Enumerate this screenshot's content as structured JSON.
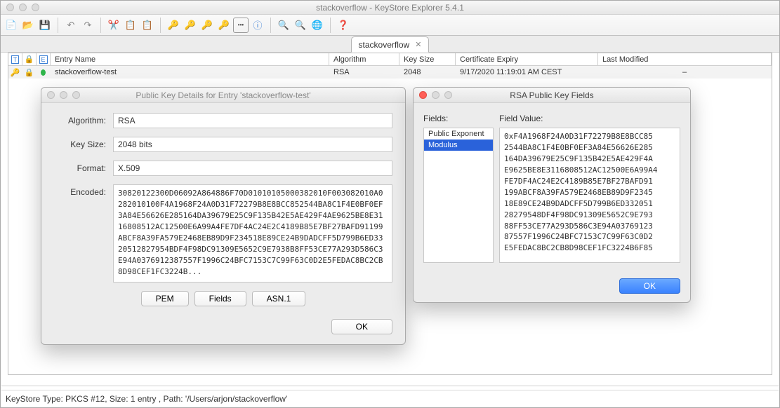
{
  "app": {
    "title": "stackoverflow - KeyStore Explorer 5.4.1",
    "tab": "stackoverflow",
    "status": "KeyStore Type: PKCS #12, Size: 1 entry , Path: '/Users/arjon/stackoverflow'"
  },
  "columns": {
    "c0": "T",
    "c1": "",
    "c2": "E",
    "c3": "Entry Name",
    "c4": "Algorithm",
    "c5": "Key Size",
    "c6": "Certificate Expiry",
    "c7": "Last Modified"
  },
  "row": {
    "entry": "stackoverflow-test",
    "algorithm": "RSA",
    "keysize": "2048",
    "expiry": "9/17/2020 11:19:01 AM CEST",
    "modified": "–"
  },
  "pk_dialog": {
    "title": "Public Key Details for Entry 'stackoverflow-test'",
    "algorithm_lbl": "Algorithm:",
    "keysize_lbl": "Key Size:",
    "format_lbl": "Format:",
    "encoded_lbl": "Encoded:",
    "algorithm": "RSA",
    "keysize": "2048 bits",
    "format": "X.509",
    "encoded": "30820122300D06092A864886F70D01010105000382010F003082010A0282010100F4A1968F24A0D31F72279B8E8BCC852544BA8C1F4E0BF0EF3A84E56626E285164DA39679E25C9F135B42E5AE429F4AE9625BE8E3116808512AC12500E6A99A4FE7DF4AC24E2C4189B85E7BF27BAFD91199ABCF8A39FA579E2468EB89D9F234518E89CE24B9DADCFF5D799B6ED3320512827954BDF4F98DC91309E5652C9E7938B8FF53CE77A293D586C3E94A0376912387557F1996C24BFC7153C7C99F63C0D2E5FEDAC8BC2CB8D98CEF1FC3224B...",
    "btn_pem": "PEM",
    "btn_fields": "Fields",
    "btn_asn1": "ASN.1",
    "btn_ok": "OK"
  },
  "rsa_dialog": {
    "title": "RSA Public Key Fields",
    "fields_lbl": "Fields:",
    "value_lbl": "Field Value:",
    "items": {
      "0": "Public Exponent",
      "1": "Modulus"
    },
    "value": "0xF4A1968F24A0D31F72279B8E8BCC85\n2544BA8C1F4E0BF0EF3A84E56626E285\n164DA39679E25C9F135B42E5AE429F4A\nE9625BE8E3116808512AC12500E6A99A4\nFE7DF4AC24E2C4189B85E7BF27BAFD91\n199ABCF8A39FA579E2468EB89D9F2345\n18E89CE24B9DADCFF5D799B6ED332051\n28279548DF4F98DC91309E5652C9E793\n88FF53CE77A293D586C3E94A03769123\n87557F1996C24BFC7153C7C99F63C0D2\nE5FEDAC8BC2CB8D98CEF1FC3224B6F85",
    "btn_ok": "OK"
  }
}
